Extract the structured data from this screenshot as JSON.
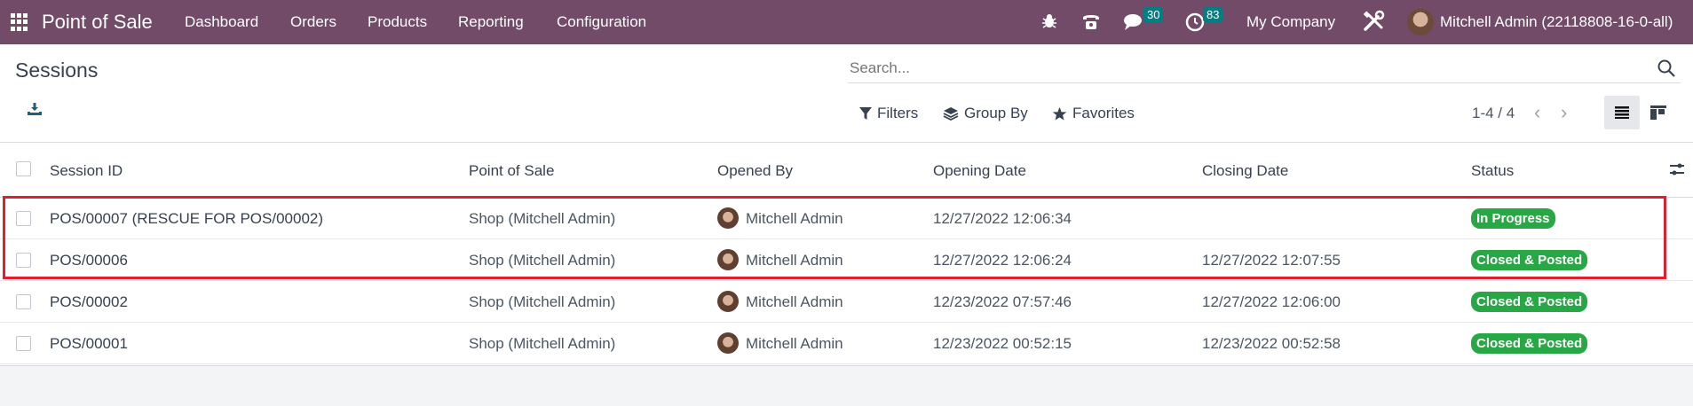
{
  "navbar": {
    "brand": "Point of Sale",
    "menu": [
      "Dashboard",
      "Orders",
      "Products",
      "Reporting",
      "Configuration"
    ],
    "messages_count": "30",
    "activities_count": "83",
    "company": "My Company",
    "user": "Mitchell Admin (22118808-16-0-all)"
  },
  "page": {
    "title": "Sessions",
    "search_placeholder": "Search...",
    "filters_label": "Filters",
    "group_by_label": "Group By",
    "favorites_label": "Favorites",
    "pager": "1-4 / 4"
  },
  "table": {
    "headers": {
      "session_id": "Session ID",
      "point_of_sale": "Point of Sale",
      "opened_by": "Opened By",
      "opening_date": "Opening Date",
      "closing_date": "Closing Date",
      "status": "Status"
    },
    "rows": [
      {
        "session_id": "POS/00007 (RESCUE FOR POS/00002)",
        "point_of_sale": "Shop (Mitchell Admin)",
        "opened_by": "Mitchell Admin",
        "opening_date": "12/27/2022 12:06:34",
        "closing_date": "",
        "status": "In Progress"
      },
      {
        "session_id": "POS/00006",
        "point_of_sale": "Shop (Mitchell Admin)",
        "opened_by": "Mitchell Admin",
        "opening_date": "12/27/2022 12:06:24",
        "closing_date": "12/27/2022 12:07:55",
        "status": "Closed & Posted"
      },
      {
        "session_id": "POS/00002",
        "point_of_sale": "Shop (Mitchell Admin)",
        "opened_by": "Mitchell Admin",
        "opening_date": "12/23/2022 07:57:46",
        "closing_date": "12/27/2022 12:06:00",
        "status": "Closed & Posted"
      },
      {
        "session_id": "POS/00001",
        "point_of_sale": "Shop (Mitchell Admin)",
        "opened_by": "Mitchell Admin",
        "opening_date": "12/23/2022 00:52:15",
        "closing_date": "12/23/2022 00:52:58",
        "status": "Closed & Posted"
      }
    ]
  },
  "colors": {
    "navbar": "#714b67",
    "badge": "#017e84",
    "status_green": "#28a745",
    "highlight": "#e0202c"
  }
}
